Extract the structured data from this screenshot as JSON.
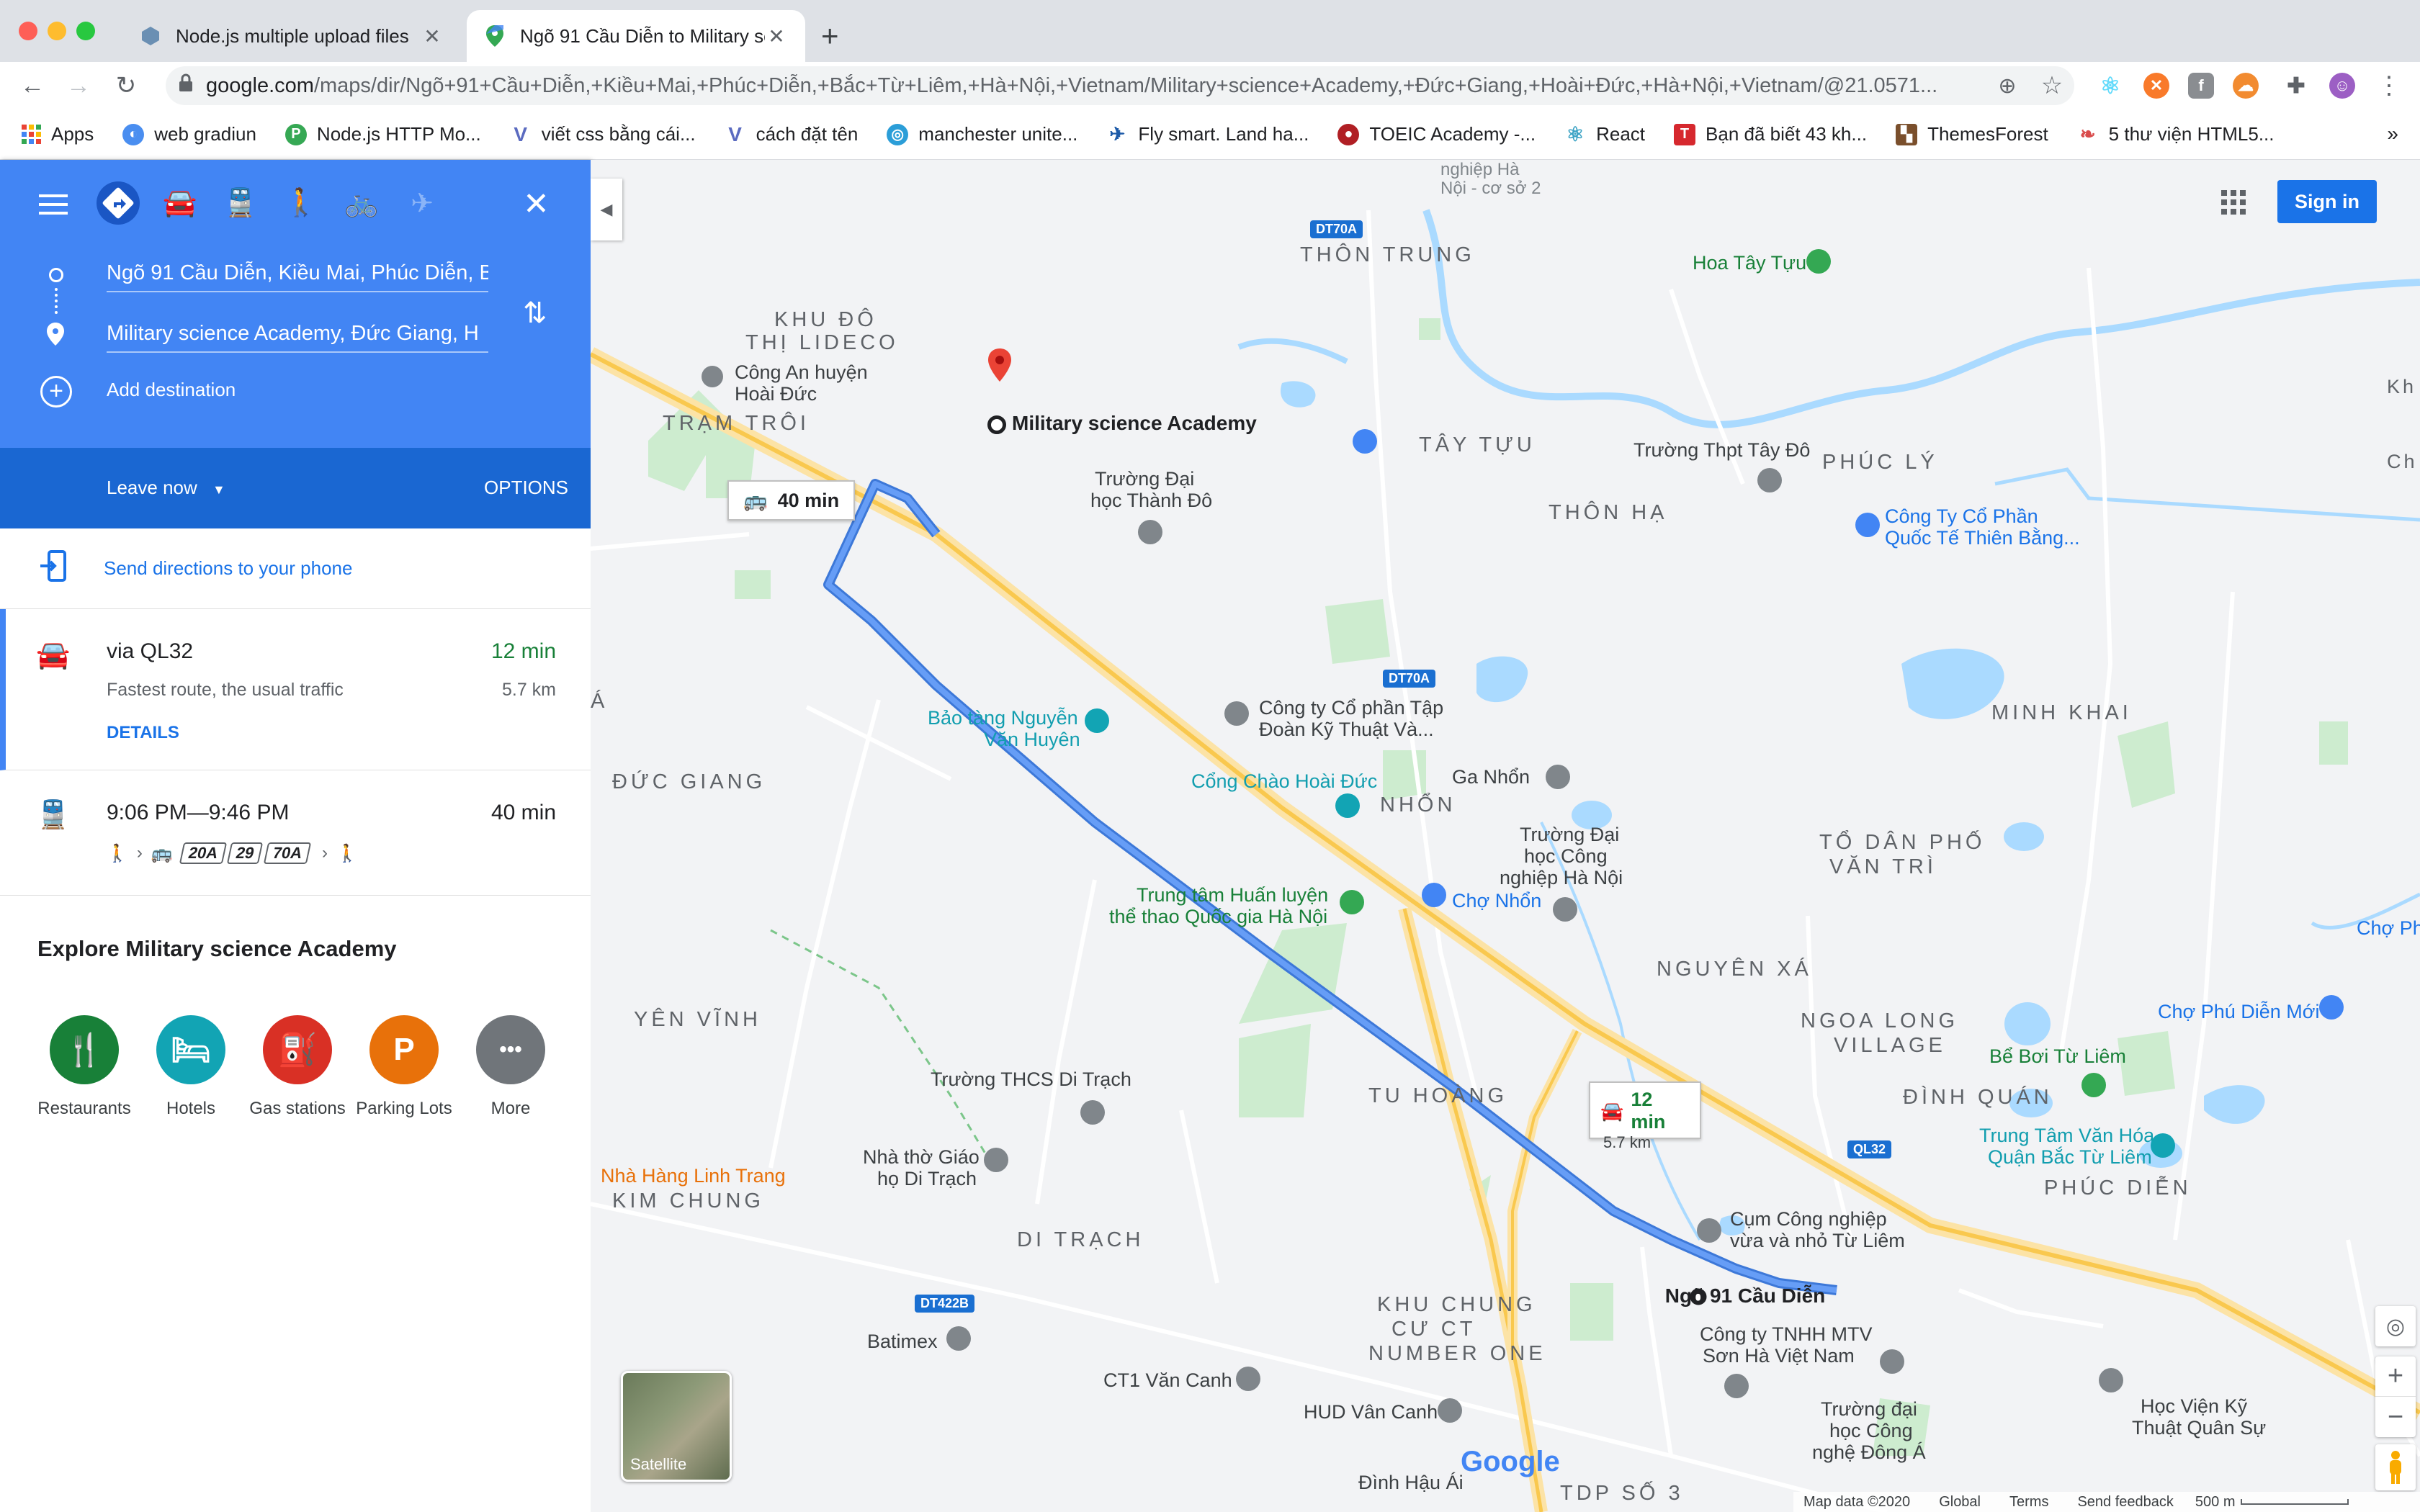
{
  "browser": {
    "tabs": [
      {
        "title": "Node.js multiple upload files",
        "active": false
      },
      {
        "title": "Ngõ 91 Cầu Diễn to Military sci",
        "active": true
      }
    ],
    "url_host": "google.com",
    "url_path": "/maps/dir/Ngõ+91+Cầu+Diễn,+Kiều+Mai,+Phúc+Diễn,+Bắc+Từ+Liêm,+Hà+Nội,+Vietnam/Military+science+Academy,+Đức+Giang,+Hoài+Đức,+Hà+Nội,+Vietnam/@21.0571...",
    "bookmarks": [
      "Apps",
      "web gradiun",
      "Node.js HTTP Mo...",
      "viết css bằng cái...",
      "cách đặt tên",
      "manchester unite...",
      "Fly smart. Land ha...",
      "TOEIC Academy -...",
      "React",
      "Bạn đã biết 43 kh...",
      "ThemesForest",
      "5 thư viện HTML5..."
    ],
    "overflow": "»"
  },
  "directions": {
    "origin": "Ngõ 91 Cầu Diễn, Kiều Mai, Phúc Diễn, B",
    "destination": "Military science Academy, Đức Giang, H",
    "add_destination": "Add destination",
    "leave_now": "Leave now",
    "options": "OPTIONS",
    "send_to_phone": "Send directions to your phone",
    "drive": {
      "via": "via QL32",
      "time": "12 min",
      "desc": "Fastest route, the usual traffic",
      "distance": "5.7 km",
      "details": "DETAILS"
    },
    "transit": {
      "time_range": "9:06 PM—9:46 PM",
      "duration": "40 min",
      "lines": [
        "20A",
        "29",
        "70A"
      ]
    },
    "explore_title": "Explore Military science Academy",
    "explore": [
      {
        "label": "Restaurants",
        "color": "#188038",
        "glyph": "🍴"
      },
      {
        "label": "Hotels",
        "color": "#12a4b4",
        "glyph": "🛏"
      },
      {
        "label": "Gas stations",
        "color": "#d93025",
        "glyph": "⛽"
      },
      {
        "label": "Parking Lots",
        "color": "#e8710a",
        "glyph": "P"
      },
      {
        "label": "More",
        "color": "#5f6368",
        "glyph": "•••"
      }
    ]
  },
  "map": {
    "sign_in": "Sign in",
    "satellite": "Satellite",
    "callout_transit": "40 min",
    "callout_drive_time": "12 min",
    "callout_drive_dist": "5.7 km",
    "destination_label": "Military science Academy",
    "origin_label": "Ngõ 91 Cầu Diễn",
    "google_logo": "Google",
    "footer": {
      "map_data": "Map data ©2020",
      "global": "Global",
      "terms": "Terms",
      "feedback": "Send feedback",
      "scale": "500 m"
    },
    "roads": {
      "dt70a_1": "DT70A",
      "dt70a_2": "DT70A",
      "ql32": "QL32",
      "dt422b": "DT422B"
    },
    "districts": {
      "thon_trung": "THÔN TRUNG",
      "khu_do_thi_1": "KHU ĐÔ",
      "khu_do_thi_2": "THỊ LIDECO",
      "tram_troi": "TRẠM TRÔI",
      "tay_tuu": "TÂY TỰU",
      "thon_ha": "THÔN HẠ",
      "phuc_ly": "PHÚC LÝ",
      "minh_khai": "MINH KHAI",
      "duc_giang": "ĐỨC GIANG",
      "nhon": "NHỔN",
      "to_dan_pho_1": "TỔ DÂN PHỐ",
      "to_dan_pho_2": "VĂN TRÌ",
      "nguyen_xa": "NGUYÊN XÁ",
      "ngoa_long_1": "NGOA LONG",
      "ngoa_long_2": "VILLAGE",
      "yen_vinh": "YÊN VĨNH",
      "tu_hoang": "TU HOÀNG",
      "dinh_quan": "ĐÌNH QUÁN",
      "phuc_dien": "PHÚC DIỄN",
      "kim_chung": "KIM CHUNG",
      "di_trach": "DI TRẠCH",
      "khu_chung_1": "KHU CHUNG",
      "khu_chung_2": "CƯ CT",
      "khu_chung_3": "NUMBER ONE",
      "tdp": "TDP SỐ 3"
    },
    "pois": {
      "hoa_tay_tuu": "Hoa Tây Tựu",
      "cong_an_1": "Công An huyện",
      "cong_an_2": "Hoài Đức",
      "truong_thanh_do_1": "Trường Đại",
      "truong_thanh_do_2": "học Thành Đô",
      "thpt_tay_do": "Trường Thpt Tây Đô",
      "cty_cp_1": "Công Ty Cổ Phần",
      "cty_cp_2": "Quốc Tế Thiên Bằng...",
      "bao_tang_1": "Bảo tàng Nguyễn",
      "bao_tang_2": "Văn Huyên",
      "cty_tap_doan_1": "Công ty Cổ phần Tập",
      "cty_tap_doan_2": "Đoàn Kỹ Thuật Và...",
      "cong_chao": "Cổng Chào Hoài Đức",
      "ga_nhon": "Ga Nhổn",
      "truong_cn_1": "Trường Đại",
      "truong_cn_2": "học Công",
      "truong_cn_3": "nghiệp Hà Nội",
      "trung_tam_1": "Trung tâm Huấn luyện",
      "trung_tam_2": "thể thao Quốc gia Hà Nội",
      "cho_nhon": "Chợ Nhổn",
      "cho_phu": "Chợ Ph",
      "cho_phu_dien": "Chợ Phú Diễn Mới",
      "be_boi": "Bể Bơi Từ Liêm",
      "trung_tam_van_hoa_1": "Trung Tâm Văn Hóa",
      "trung_tam_van_hoa_2": "Quận Bắc Từ Liêm",
      "thcs_di_trach": "Trường THCS Di Trạch",
      "nha_tho_1": "Nhà thờ Giáo",
      "nha_tho_2": "họ Di Trạch",
      "nha_hang": "Nhà Hàng Linh Trang",
      "cum_cn_1": "Cụm Công nghiệp",
      "cum_cn_2": "vừa và nhỏ Từ Liêm",
      "batimex": "Batimex",
      "ct1": "CT1 Văn Canh",
      "hud": "HUD Vân Canh",
      "cty_tnhh_1": "Công ty TNHH MTV",
      "cty_tnhh_2": "Sơn Hà Việt Nam",
      "truong_cn_dong_a_1": "Trường đại",
      "truong_cn_dong_a_2": "học Công",
      "truong_cn_dong_a_3": "nghệ Đông Á",
      "hoc_vien_1": "Học Viện Kỹ",
      "hoc_vien_2": "Thuật Quân Sự",
      "dinh_hau_ai": "Đình Hậu Ái",
      "top_partial_1": "nghiệp Hà",
      "top_partial_2": "Nội - cơ sở 2",
      "right_partial_1": "Kh",
      "right_partial_2": "Ch",
      "a_partial": "Á"
    }
  }
}
